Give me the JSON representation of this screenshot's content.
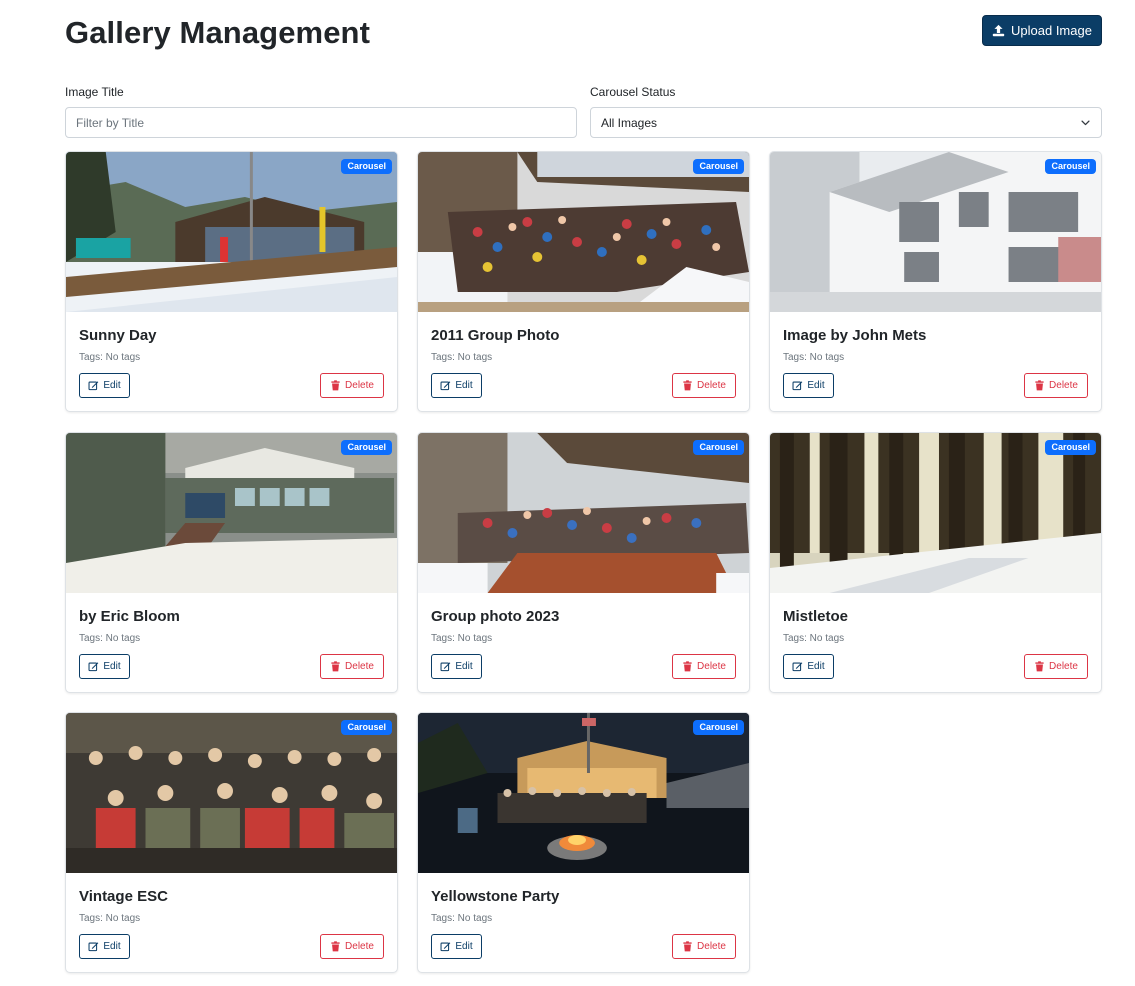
{
  "page": {
    "title": "Gallery Management",
    "upload_label": "Upload Image"
  },
  "filters": {
    "title_label": "Image Title",
    "title_placeholder": "Filter by Title",
    "title_value": "",
    "status_label": "Carousel Status",
    "status_selected": "All Images"
  },
  "colors": {
    "primary": "#0b3d66",
    "badge": "#0d6efd",
    "danger": "#dc3545"
  },
  "cards": [
    {
      "title": "Sunny Day",
      "tags": "Tags: No tags",
      "badge": "Carousel",
      "edit_label": "Edit",
      "delete_label": "Delete",
      "scene": "lodge-sunny"
    },
    {
      "title": "2011 Group Photo",
      "tags": "Tags: No tags",
      "badge": "Carousel",
      "edit_label": "Edit",
      "delete_label": "Delete",
      "scene": "group-deck"
    },
    {
      "title": "Image by John Mets",
      "tags": "Tags: No tags",
      "badge": "Carousel",
      "edit_label": "Edit",
      "delete_label": "Delete",
      "scene": "white-house"
    },
    {
      "title": "by Eric Bloom",
      "tags": "Tags: No tags",
      "badge": "Carousel",
      "edit_label": "Edit",
      "delete_label": "Delete",
      "scene": "snowy-lodge"
    },
    {
      "title": "Group photo 2023",
      "tags": "Tags: No tags",
      "badge": "Carousel",
      "edit_label": "Edit",
      "delete_label": "Delete",
      "scene": "group-snow"
    },
    {
      "title": "Mistletoe",
      "tags": "Tags: No tags",
      "badge": "Carousel",
      "edit_label": "Edit",
      "delete_label": "Delete",
      "scene": "forest"
    },
    {
      "title": "Vintage ESC",
      "tags": "Tags: No tags",
      "badge": "Carousel",
      "edit_label": "Edit",
      "delete_label": "Delete",
      "scene": "vintage-group"
    },
    {
      "title": "Yellowstone Party",
      "tags": "Tags: No tags",
      "badge": "Carousel",
      "edit_label": "Edit",
      "delete_label": "Delete",
      "scene": "night-fire"
    }
  ]
}
